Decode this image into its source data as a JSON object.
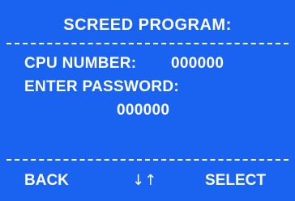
{
  "screen": {
    "title": "SCREED PROGRAM:",
    "cpu_label": "CPU NUMBER:",
    "cpu_number": "000000",
    "password_label": "ENTER PASSWORD:",
    "password_value": "000000"
  },
  "softkeys": {
    "back": "BACK",
    "arrows": "↓↑",
    "select": "SELECT"
  },
  "colors": {
    "background": "#1a63f0",
    "text": "#ffffff"
  }
}
